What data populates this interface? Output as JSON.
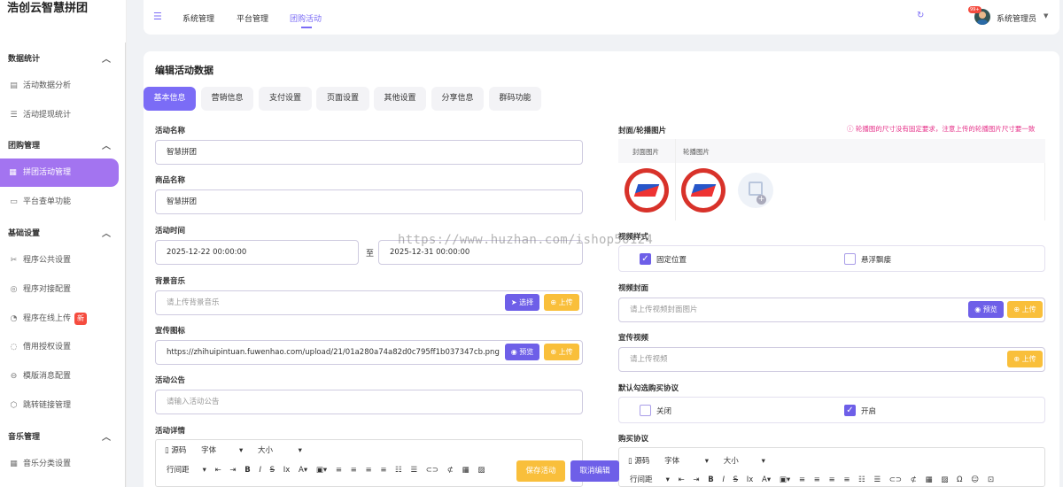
{
  "app": {
    "title": "浩创云智慧拼团"
  },
  "sidebar": {
    "groups": [
      {
        "label": "数据统计",
        "items": [
          {
            "label": "活动数据分析",
            "icon": "document-icon"
          },
          {
            "label": "活动提现统计",
            "icon": "list-icon"
          }
        ]
      },
      {
        "label": "团购管理",
        "items": [
          {
            "label": "拼团活动管理",
            "icon": "grid-icon"
          },
          {
            "label": "平台查单功能",
            "icon": "search-window-icon"
          }
        ]
      },
      {
        "label": "基础设置",
        "items": [
          {
            "label": "程序公共设置",
            "icon": "tools-icon"
          },
          {
            "label": "程序对接配置",
            "icon": "compass-icon"
          },
          {
            "label": "程序在线上传",
            "icon": "rss-icon",
            "badge": "新"
          },
          {
            "label": "借用授权设置",
            "icon": "circle-icon"
          },
          {
            "label": "模版消息配置",
            "icon": "message-icon"
          },
          {
            "label": "跳转链接管理",
            "icon": "cube-icon"
          }
        ]
      },
      {
        "label": "音乐管理",
        "items": [
          {
            "label": "音乐分类设置",
            "icon": "grid-icon"
          }
        ]
      }
    ],
    "active": "拼团活动管理"
  },
  "topbar": {
    "nav": [
      "系统管理",
      "平台管理",
      "团购活动"
    ],
    "active_nav": "团购活动",
    "badge": "99+",
    "user": "系统管理员"
  },
  "page": {
    "title": "编辑活动数据",
    "tabs": [
      "基本信息",
      "营销信息",
      "支付设置",
      "页面设置",
      "其他设置",
      "分享信息",
      "群码功能"
    ],
    "active_tab": "基本信息"
  },
  "form": {
    "activity_name": {
      "label": "活动名称",
      "value": "智慧拼团"
    },
    "product_name": {
      "label": "商品名称",
      "value": "智慧拼团"
    },
    "activity_time": {
      "label": "活动时间",
      "start": "2025-12-22 00:00:00",
      "to": "至",
      "end": "2025-12-31 00:00:00"
    },
    "bg_music": {
      "label": "背景音乐",
      "placeholder": "请上传背景音乐",
      "select_btn": "选择",
      "upload_btn": "上传"
    },
    "promo_icon": {
      "label": "宣传图标",
      "value": "https://zhihuipintuan.fuwenhao.com/upload/21/01a280a74a82d0c795ff1b037347cb.png",
      "preview_btn": "预览",
      "upload_btn": "上传"
    },
    "announcement": {
      "label": "活动公告",
      "placeholder": "请输入活动公告"
    },
    "details": {
      "label": "活动详情"
    }
  },
  "right": {
    "cover_label": "封面/轮播图片",
    "cover_info": "轮播图的尺寸没有固定要求，注意上传的轮播图片尺寸要一致",
    "cover_col": "封面图片",
    "carousel_col": "轮播图片",
    "video_style": {
      "label": "视频样式",
      "opt1": "固定位置",
      "opt2": "悬浮飘瘘"
    },
    "video_cover": {
      "label": "视频封面",
      "placeholder": "请上传视频封面图片",
      "preview_btn": "预览",
      "upload_btn": "上传"
    },
    "promo_video": {
      "label": "宣传视频",
      "placeholder": "请上传视频",
      "upload_btn": "上传"
    },
    "default_agreement": {
      "label": "默认勾选购买协议",
      "opt1": "关闭",
      "opt2": "开启"
    },
    "purchase_agreement": {
      "label": "购买协议"
    }
  },
  "editor": {
    "source": "源码",
    "font": "字体",
    "size": "大小",
    "line_height": "行间距"
  },
  "actions": {
    "save": "保存活动",
    "cancel": "取消编辑"
  },
  "watermark": "https://www.huzhan.com/ishop50124",
  "colors": {
    "accent": "#7b6cf6",
    "orange": "#f9bf3b",
    "sidebar_active": "#a374f0",
    "info": "#e6338a"
  }
}
